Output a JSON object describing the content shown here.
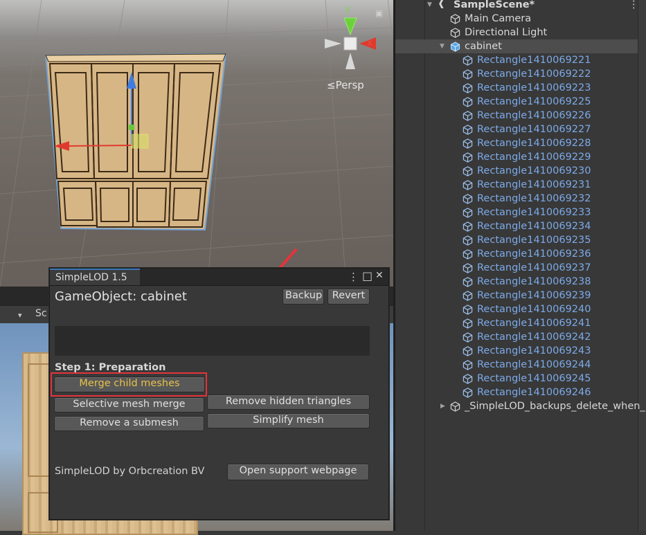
{
  "scene": {
    "persp_label": "≤Persp",
    "gizmo_y": "y",
    "gizmo_x": "x"
  },
  "game_view": {
    "toolbar_label": "Sc",
    "dropdown_icon": "▾"
  },
  "hierarchy": {
    "scene_name": "SampleScene*",
    "items": [
      {
        "label": "Main Camera",
        "indent": 1
      },
      {
        "label": "Directional Light",
        "indent": 1
      },
      {
        "label": "cabinet",
        "indent": 1,
        "expanded": true,
        "selected": true
      },
      {
        "label": "Rectangle1410069221",
        "indent": 2
      },
      {
        "label": "Rectangle1410069222",
        "indent": 2
      },
      {
        "label": "Rectangle1410069223",
        "indent": 2
      },
      {
        "label": "Rectangle1410069225",
        "indent": 2
      },
      {
        "label": "Rectangle1410069226",
        "indent": 2
      },
      {
        "label": "Rectangle1410069227",
        "indent": 2
      },
      {
        "label": "Rectangle1410069228",
        "indent": 2
      },
      {
        "label": "Rectangle1410069229",
        "indent": 2
      },
      {
        "label": "Rectangle1410069230",
        "indent": 2
      },
      {
        "label": "Rectangle1410069231",
        "indent": 2
      },
      {
        "label": "Rectangle1410069232",
        "indent": 2
      },
      {
        "label": "Rectangle1410069233",
        "indent": 2
      },
      {
        "label": "Rectangle1410069234",
        "indent": 2
      },
      {
        "label": "Rectangle1410069235",
        "indent": 2
      },
      {
        "label": "Rectangle1410069236",
        "indent": 2
      },
      {
        "label": "Rectangle1410069237",
        "indent": 2
      },
      {
        "label": "Rectangle1410069238",
        "indent": 2
      },
      {
        "label": "Rectangle1410069239",
        "indent": 2
      },
      {
        "label": "Rectangle1410069240",
        "indent": 2
      },
      {
        "label": "Rectangle1410069241",
        "indent": 2
      },
      {
        "label": "Rectangle1410069242",
        "indent": 2
      },
      {
        "label": "Rectangle1410069243",
        "indent": 2
      },
      {
        "label": "Rectangle1410069244",
        "indent": 2
      },
      {
        "label": "Rectangle1410069245",
        "indent": 2
      },
      {
        "label": "Rectangle1410069246",
        "indent": 2
      },
      {
        "label": "_SimpleLOD_backups_delete_when_",
        "indent": 1,
        "collapsed": true
      }
    ],
    "menu_icon": "⋮"
  },
  "simplelod": {
    "tab_title": "SimpleLOD 1.5",
    "gameobject_label": "GameObject: cabinet",
    "backup_button": "Backup",
    "revert_button": "Revert",
    "step1_heading": "Step 1: Preparation",
    "merge_child_meshes": "Merge child meshes",
    "selective_mesh_merge": "Selective mesh merge",
    "remove_hidden_triangles": "Remove hidden triangles",
    "remove_a_submesh": "Remove a submesh",
    "simplify_mesh": "Simplify mesh",
    "credit": "SimpleLOD by Orbcreation BV",
    "open_support": "Open support webpage",
    "menu_icon": "⋮",
    "maximize_icon": "□",
    "close_icon": "✕"
  },
  "colors": {
    "highlight_text": "#e8c24a",
    "annotation_red": "#e5333a",
    "hierarchy_blue": "#7caae8"
  }
}
